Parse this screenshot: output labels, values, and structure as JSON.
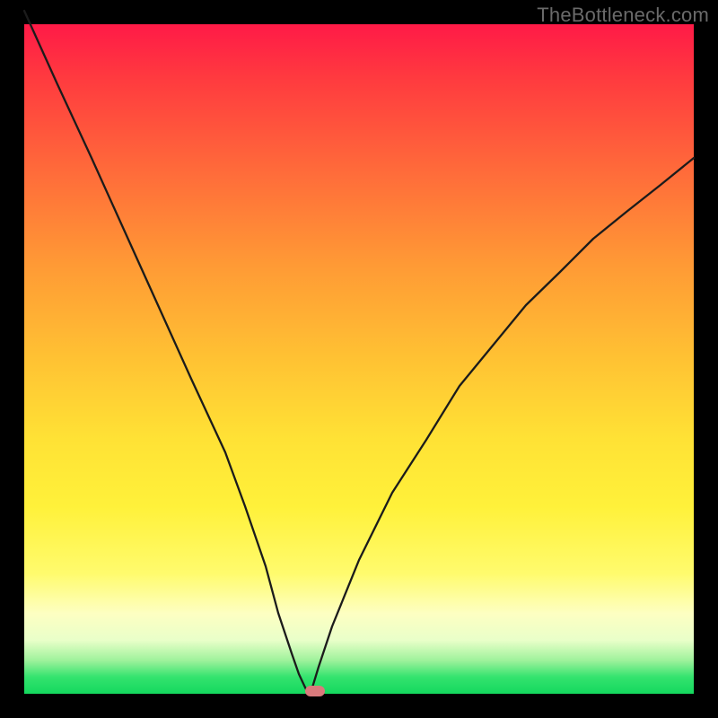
{
  "watermark": "TheBottleneck.com",
  "colors": {
    "background": "#000000",
    "gradient_top": "#ff1a47",
    "gradient_mid": "#ffe235",
    "gradient_bottom": "#14d85e",
    "curve_stroke": "#1b1b1b",
    "marker": "#d97a7c",
    "watermark_text": "#6a6a6a"
  },
  "chart_data": {
    "type": "line",
    "title": "",
    "xlabel": "",
    "ylabel": "",
    "xlim": [
      0,
      100
    ],
    "ylim": [
      0,
      100
    ],
    "x": [
      0,
      5,
      10,
      15,
      20,
      25,
      30,
      33,
      36,
      38,
      40,
      41,
      42,
      42.5,
      43,
      44,
      46,
      50,
      55,
      60,
      65,
      70,
      75,
      80,
      85,
      90,
      95,
      100
    ],
    "values": [
      102,
      91,
      80,
      69,
      58,
      47,
      36,
      28,
      19,
      12,
      6,
      3,
      1,
      0,
      1,
      4,
      10,
      20,
      30,
      38,
      46,
      52,
      58,
      63,
      68,
      72,
      76,
      80
    ],
    "minimum": {
      "x": 42.5,
      "y": 0
    },
    "marker": {
      "x": 43.5,
      "y": 0
    },
    "note": "V-shaped bottleneck curve; x and y are percentage-like scales with no visible axis ticks."
  }
}
